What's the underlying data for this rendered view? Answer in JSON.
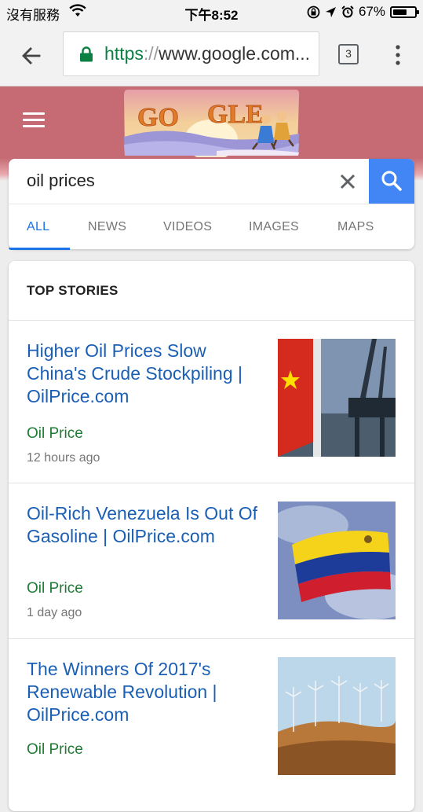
{
  "status_bar": {
    "carrier": "沒有服務",
    "time": "下午8:52",
    "battery": "67%",
    "battery_level": 0.67
  },
  "browser": {
    "url_scheme": "https",
    "url_sep": "://",
    "url_host": "www.google.com...",
    "tab_count": "3"
  },
  "search": {
    "query": "oil prices",
    "tabs": [
      "ALL",
      "NEWS",
      "VIDEOS",
      "IMAGES",
      "MAPS"
    ],
    "active_tab": "ALL"
  },
  "top_stories": {
    "title": "TOP STORIES",
    "items": [
      {
        "headline": "Higher Oil Prices Slow China's Crude Stockpiling | OilPrice.com",
        "source": "Oil Price",
        "time": "12 hours ago",
        "thumbnail": "china-flag-oil-rig"
      },
      {
        "headline": "Oil-Rich Venezuela Is Out Of Gasoline | OilPrice.com",
        "source": "Oil Price",
        "time": "1 day ago",
        "thumbnail": "venezuela-flag"
      },
      {
        "headline": "The Winners Of 2017's Renewable Revolution | OilPrice.com",
        "source": "Oil Price",
        "time": "",
        "thumbnail": "wind-turbines"
      }
    ]
  },
  "colors": {
    "header_bg": "#c66b74",
    "search_button": "#4285f4",
    "link": "#1a5fb4",
    "source": "#1e7b34",
    "active_tab": "#1a73e8"
  }
}
